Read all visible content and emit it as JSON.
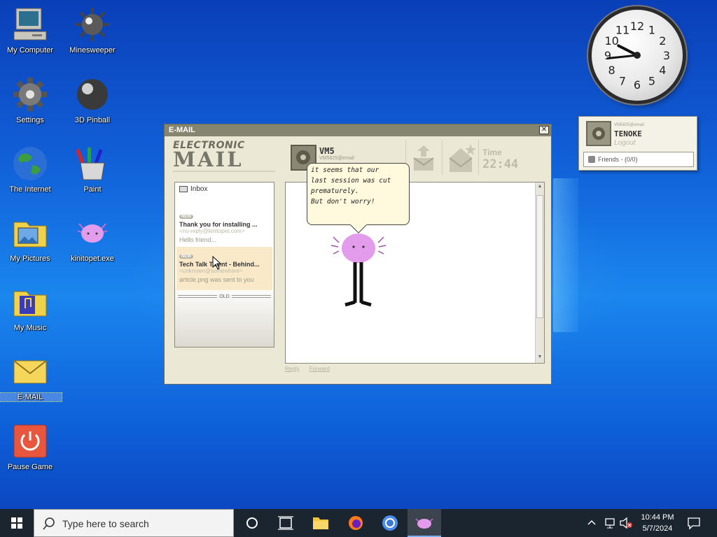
{
  "desktop_icons": [
    {
      "label": "My Computer",
      "icon": "computer-icon"
    },
    {
      "label": "Minesweeper",
      "icon": "mine-icon"
    },
    {
      "label": "Settings",
      "icon": "gear-icon"
    },
    {
      "label": "3D Pinball",
      "icon": "pinball-icon"
    },
    {
      "label": "The Internet",
      "icon": "globe-icon"
    },
    {
      "label": "Paint",
      "icon": "paint-icon"
    },
    {
      "label": "My Pictures",
      "icon": "pictures-folder-icon"
    },
    {
      "label": "kinitopet.exe",
      "icon": "axolotl-icon"
    },
    {
      "label": "My Music",
      "icon": "music-folder-icon"
    },
    {
      "label": "E-MAIL",
      "icon": "envelope-icon"
    },
    {
      "label": "Pause Game",
      "icon": "power-icon"
    }
  ],
  "clock": {
    "numbers": [
      "12",
      "1",
      "2",
      "3",
      "4",
      "5",
      "6",
      "7",
      "8",
      "9",
      "10",
      "11"
    ],
    "hour": 9.9,
    "minute": 44
  },
  "login_gadget": {
    "email": "VM5825@email",
    "username": "TENOKE",
    "logout_label": "Logout",
    "friends_label": "Friends - (0/0)"
  },
  "email_window": {
    "title": "E-MAIL",
    "close_glyph": "✕",
    "logo_top": "ELECTRONIC",
    "logo_bottom": "MAIL",
    "account_name": "VM5",
    "account_email": "VM5825@email",
    "time_label": "Time",
    "time_value": "22:44",
    "inbox_label": "Inbox",
    "badge_new": "NEW",
    "messages": [
      {
        "subject": "Thank you for installing ...",
        "from": "<no-reply@kinitopet.com>",
        "preview": "Hello friend..."
      },
      {
        "subject": "Tech Talk Talent - Behind...",
        "from": "<unknown@somewhere>",
        "preview": "article.png was sent to you"
      }
    ],
    "old_label": "OLD",
    "reply_label": "Reply",
    "forward_label": "Forward"
  },
  "speech_bubble": "it seems that our\nlast session was cut\nprematurely.\nBut don't worry!",
  "taskbar": {
    "search_placeholder": "Type here to search",
    "time": "10:44 PM",
    "date": "5/7/2024"
  },
  "colors": {
    "accent": "#7db2f0",
    "window_bg": "#ebe8d6",
    "title_bar": "#86856f",
    "highlight_row": "#fae9c8"
  }
}
